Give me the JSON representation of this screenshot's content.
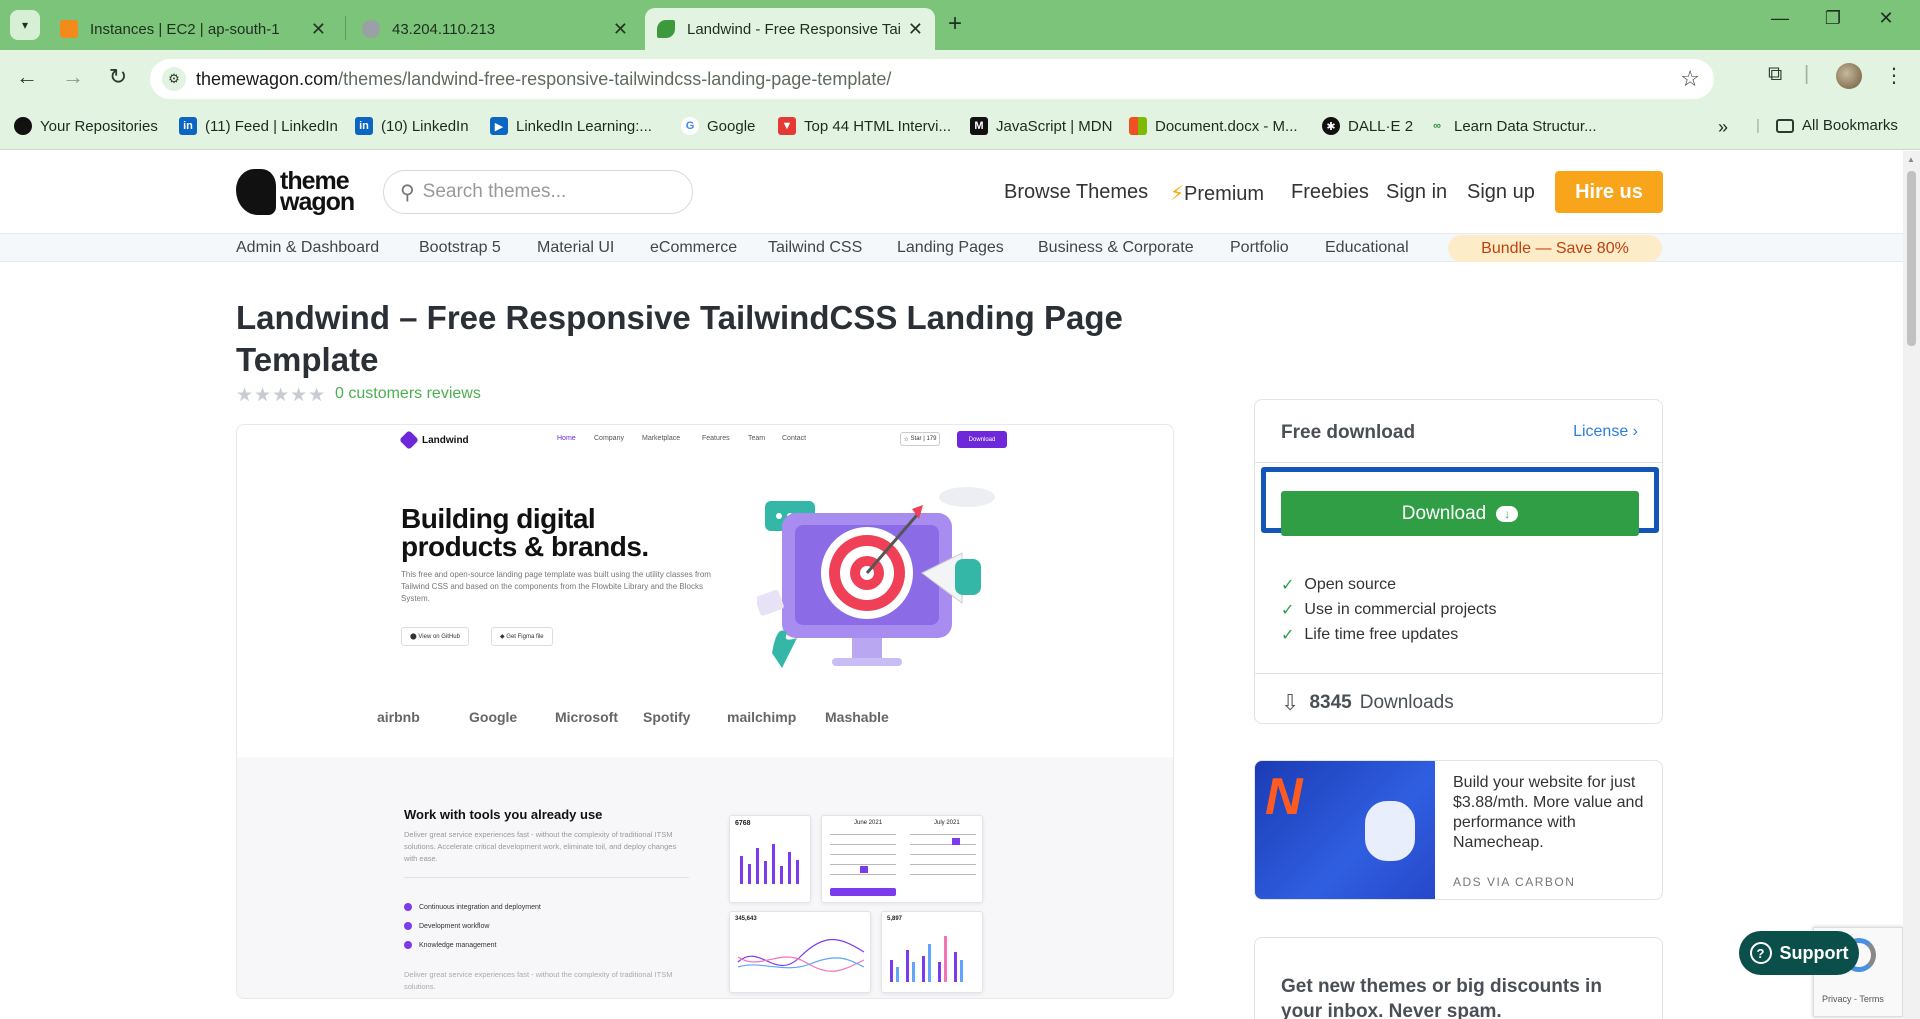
{
  "tabs": [
    {
      "title": "Instances | EC2 | ap-south-1",
      "favicon_color": "#f38b1c"
    },
    {
      "title": "43.204.110.213",
      "favicon_color": "#9aa0a6"
    },
    {
      "title": "Landwind - Free Responsive Tail",
      "favicon_color": "#3c9a3c"
    }
  ],
  "address_bar": {
    "host": "themewagon.com",
    "path": "/themes/landwind-free-responsive-tailwindcss-landing-page-template/"
  },
  "bookmarks": [
    {
      "label": "Your Repositories",
      "icon": "github-icon",
      "icon_color": "#111111"
    },
    {
      "label": "(11) Feed | LinkedIn",
      "icon": "linkedin-icon",
      "icon_color": "#0a66c2"
    },
    {
      "label": "(10) LinkedIn",
      "icon": "linkedin-icon",
      "icon_color": "#0a66c2"
    },
    {
      "label": "LinkedIn Learning:...",
      "icon": "linkedin-learning-icon",
      "icon_color": "#0a66c2"
    },
    {
      "label": "Google",
      "icon": "google-icon",
      "icon_color": "#4285f4"
    },
    {
      "label": "Top 44 HTML Intervi...",
      "icon": "bookmark-site-icon",
      "icon_color": "#e53935"
    },
    {
      "label": "JavaScript | MDN",
      "icon": "mdn-icon",
      "icon_color": "#111111"
    },
    {
      "label": "Document.docx - M...",
      "icon": "microsoft-icon",
      "icon_color": "#f25022"
    },
    {
      "label": "DALL·E 2",
      "icon": "openai-icon",
      "icon_color": "#111111"
    },
    {
      "label": "Learn Data Structur...",
      "icon": "gfg-icon",
      "icon_color": "#2f8d46"
    }
  ],
  "all_bookmarks_label": "All Bookmarks",
  "site": {
    "logo_line1": "theme",
    "logo_line2": "wagon",
    "search_placeholder": "Search themes...",
    "nav": {
      "browse": "Browse Themes",
      "premium": "Premium",
      "freebies": "Freebies",
      "signin": "Sign in",
      "signup": "Sign up",
      "hire": "Hire us"
    },
    "categories": [
      "Admin & Dashboard",
      "Bootstrap 5",
      "Material UI",
      "eCommerce",
      "Tailwind CSS",
      "Landing Pages",
      "Business & Corporate",
      "Portfolio",
      "Educational"
    ],
    "bundle": "Bundle — Save 80%"
  },
  "product": {
    "title": "Landwind – Free Responsive TailwindCSS Landing Page Template",
    "rating_stars": 0,
    "reviews": "0 customers reviews"
  },
  "preview": {
    "brand": "Landwind",
    "nav": [
      "Home",
      "Company",
      "Marketplace",
      "Features",
      "Team",
      "Contact"
    ],
    "star_label": "Star",
    "star_count": "179",
    "download_label": "Download",
    "headline": "Building digital products & brands.",
    "body": "This free and open-source landing page template was built using the utility classes from Tailwind CSS and based on the components from the Flowbite Library and the Blocks System.",
    "btn_github": "View on GitHub",
    "btn_figma": "Get Figma file",
    "logos": [
      "airbnb",
      "Google",
      "Microsoft",
      "Spotify",
      "mailchimp",
      "Mashable"
    ],
    "section_title": "Work with tools you already use",
    "section_body": "Deliver great service experiences fast - without the complexity of traditional ITSM solutions. Accelerate critical development work, eliminate toil, and deploy changes with ease.",
    "checks": [
      "Continuous integration and deployment",
      "Development workflow",
      "Knowledge management"
    ],
    "section_body_2": "Deliver great service experiences fast - without the complexity of traditional ITSM solutions.",
    "card_1_value": "6768",
    "calendar_1_month": "June 2021",
    "calendar_2_month": "July 2021",
    "card_3_value": "345,643",
    "card_4_value": "5,897",
    "accent_color": "#6d28d9"
  },
  "download_card": {
    "heading": "Free download",
    "license": "License",
    "button": "Download",
    "features": [
      "Open source",
      "Use in commercial projects",
      "Life time free updates"
    ],
    "count": "8345",
    "count_label": "Downloads",
    "button_color": "#2f9e44"
  },
  "ad": {
    "text": "Build your website for just $3.88/mth. More value and performance with Namecheap.",
    "via": "ADS VIA CARBON"
  },
  "newsletter": {
    "text": "Get new themes or big discounts in your inbox. Never spam."
  },
  "support_label": "Support",
  "recaptcha_text": "Privacy - Terms"
}
